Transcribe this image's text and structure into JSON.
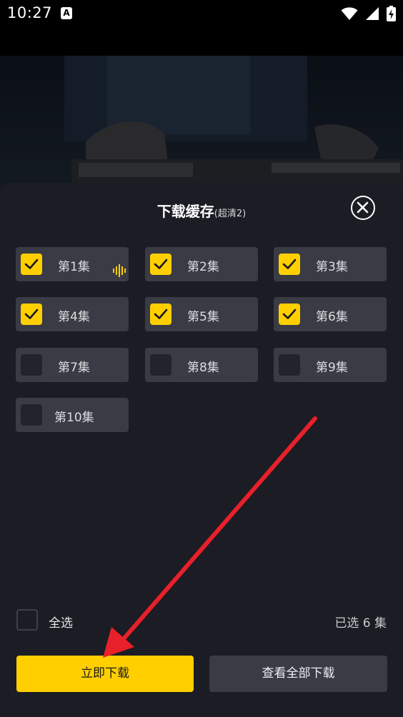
{
  "status_bar": {
    "time": "10:27",
    "notification_icon": "A"
  },
  "sheet": {
    "title": "下载缓存",
    "quality": "(超清2)"
  },
  "episodes": [
    {
      "label": "第1集",
      "checked": true,
      "playing": true
    },
    {
      "label": "第2集",
      "checked": true
    },
    {
      "label": "第3集",
      "checked": true
    },
    {
      "label": "第4集",
      "checked": true
    },
    {
      "label": "第5集",
      "checked": true
    },
    {
      "label": "第6集",
      "checked": true
    },
    {
      "label": "第7集",
      "checked": false
    },
    {
      "label": "第8集",
      "checked": false
    },
    {
      "label": "第9集",
      "checked": false
    },
    {
      "label": "第10集",
      "checked": false
    }
  ],
  "footer": {
    "select_all_label": "全选",
    "selected_count": "已选 6 集",
    "download_now": "立即下载",
    "view_all_downloads": "查看全部下载"
  },
  "colors": {
    "accent": "#ffcf00",
    "sheet_bg": "#1b1c24",
    "tile_bg": "#3a3b44",
    "annotation_arrow": "#e8202a"
  }
}
